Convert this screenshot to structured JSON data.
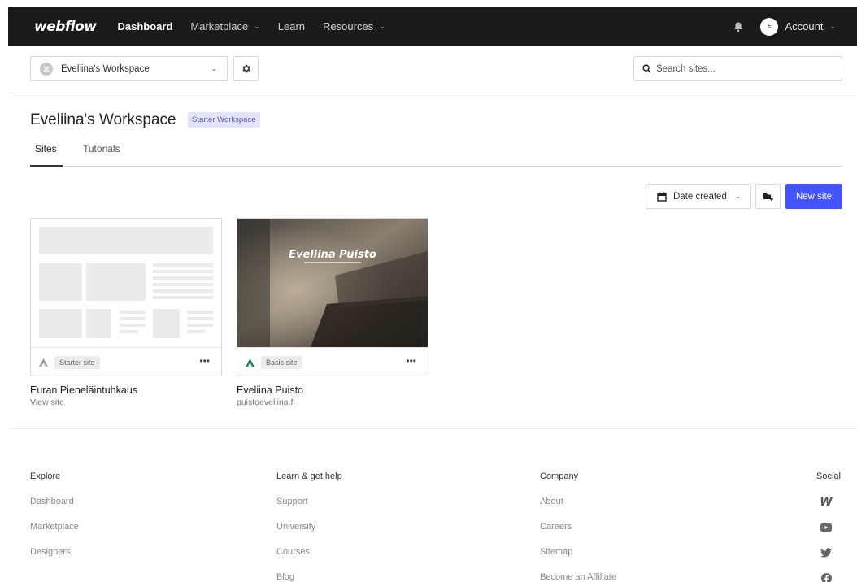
{
  "nav": {
    "logo": "webflow",
    "items": [
      {
        "label": "Dashboard"
      },
      {
        "label": "Marketplace"
      },
      {
        "label": "Learn"
      },
      {
        "label": "Resources"
      }
    ],
    "account_label": "Account",
    "avatar_initial": "E"
  },
  "toolbar": {
    "workspace_select": "Eveliina's Workspace",
    "search_placeholder": "Search sites..."
  },
  "header": {
    "title": "Eveliina's Workspace",
    "badge": "Starter Workspace",
    "tabs": [
      {
        "label": "Sites"
      },
      {
        "label": "Tutorials"
      }
    ]
  },
  "actions": {
    "sort_label": "Date created",
    "new_site_label": "New site"
  },
  "sites": [
    {
      "name": "Euran Pieneläintuhkaus",
      "subtitle": "View site",
      "plan": "Starter site"
    },
    {
      "name": "Eveliina Puisto",
      "subtitle": "puistoeveliina.fi",
      "plan": "Basic site",
      "thumb_title": "Eveliina Puisto"
    }
  ],
  "footer": {
    "explore": {
      "heading": "Explore",
      "links": [
        "Dashboard",
        "Marketplace",
        "Designers"
      ]
    },
    "learn": {
      "heading": "Learn & get help",
      "links": [
        "Support",
        "University",
        "Courses",
        "Blog"
      ]
    },
    "company": {
      "heading": "Company",
      "links": [
        "About",
        "Careers",
        "Sitemap",
        "Become an Affiliate"
      ]
    },
    "social": {
      "heading": "Social",
      "icons": [
        "webflow-icon",
        "youtube-icon",
        "twitter-icon",
        "facebook-icon"
      ]
    }
  },
  "colors": {
    "accent": "#4353ff",
    "nav_bg": "#1a1a1a",
    "badge_bg": "#e3e3fb"
  }
}
